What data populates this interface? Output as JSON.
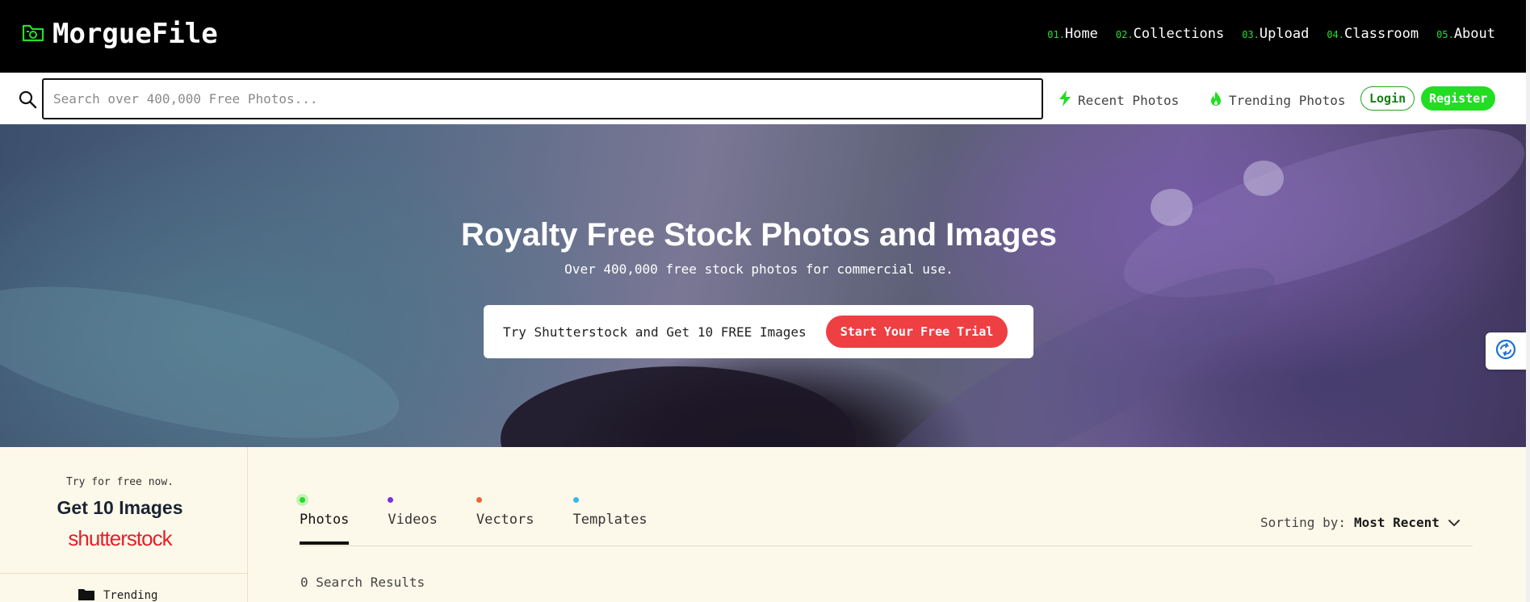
{
  "brand": {
    "name": "MorgueFile",
    "accent": "#22e02a"
  },
  "nav": [
    {
      "num": "01.",
      "label": "Home"
    },
    {
      "num": "02.",
      "label": "Collections"
    },
    {
      "num": "03.",
      "label": "Upload"
    },
    {
      "num": "04.",
      "label": "Classroom"
    },
    {
      "num": "05.",
      "label": "About"
    }
  ],
  "search": {
    "placeholder": "Search over 400,000 Free Photos...",
    "value": ""
  },
  "quick_links": {
    "recent": "Recent Photos",
    "trending": "Trending Photos"
  },
  "auth": {
    "login": "Login",
    "register": "Register"
  },
  "hero": {
    "title": "Royalty Free Stock Photos and Images",
    "subtitle": "Over 400,000 free stock photos for commercial use.",
    "promo_text": "Try Shutterstock and Get 10 FREE Images",
    "promo_button": "Start Your Free Trial",
    "promo_color": "#ee3f43"
  },
  "sidebar": {
    "try_text": "Try for free now.",
    "get_text": "Get 10 Images",
    "logo_text": "shutterstock",
    "trending_label": "Trending"
  },
  "tabs": [
    {
      "label": "Photos",
      "color": "#22dd22",
      "active": true
    },
    {
      "label": "Videos",
      "color": "#7b2fe0",
      "active": false
    },
    {
      "label": "Vectors",
      "color": "#e8663a",
      "active": false
    },
    {
      "label": "Templates",
      "color": "#3bb6e8",
      "active": false
    }
  ],
  "sorting": {
    "label": "Sorting by:",
    "value": "Most Recent"
  },
  "results": {
    "text": "0 Search Results"
  }
}
